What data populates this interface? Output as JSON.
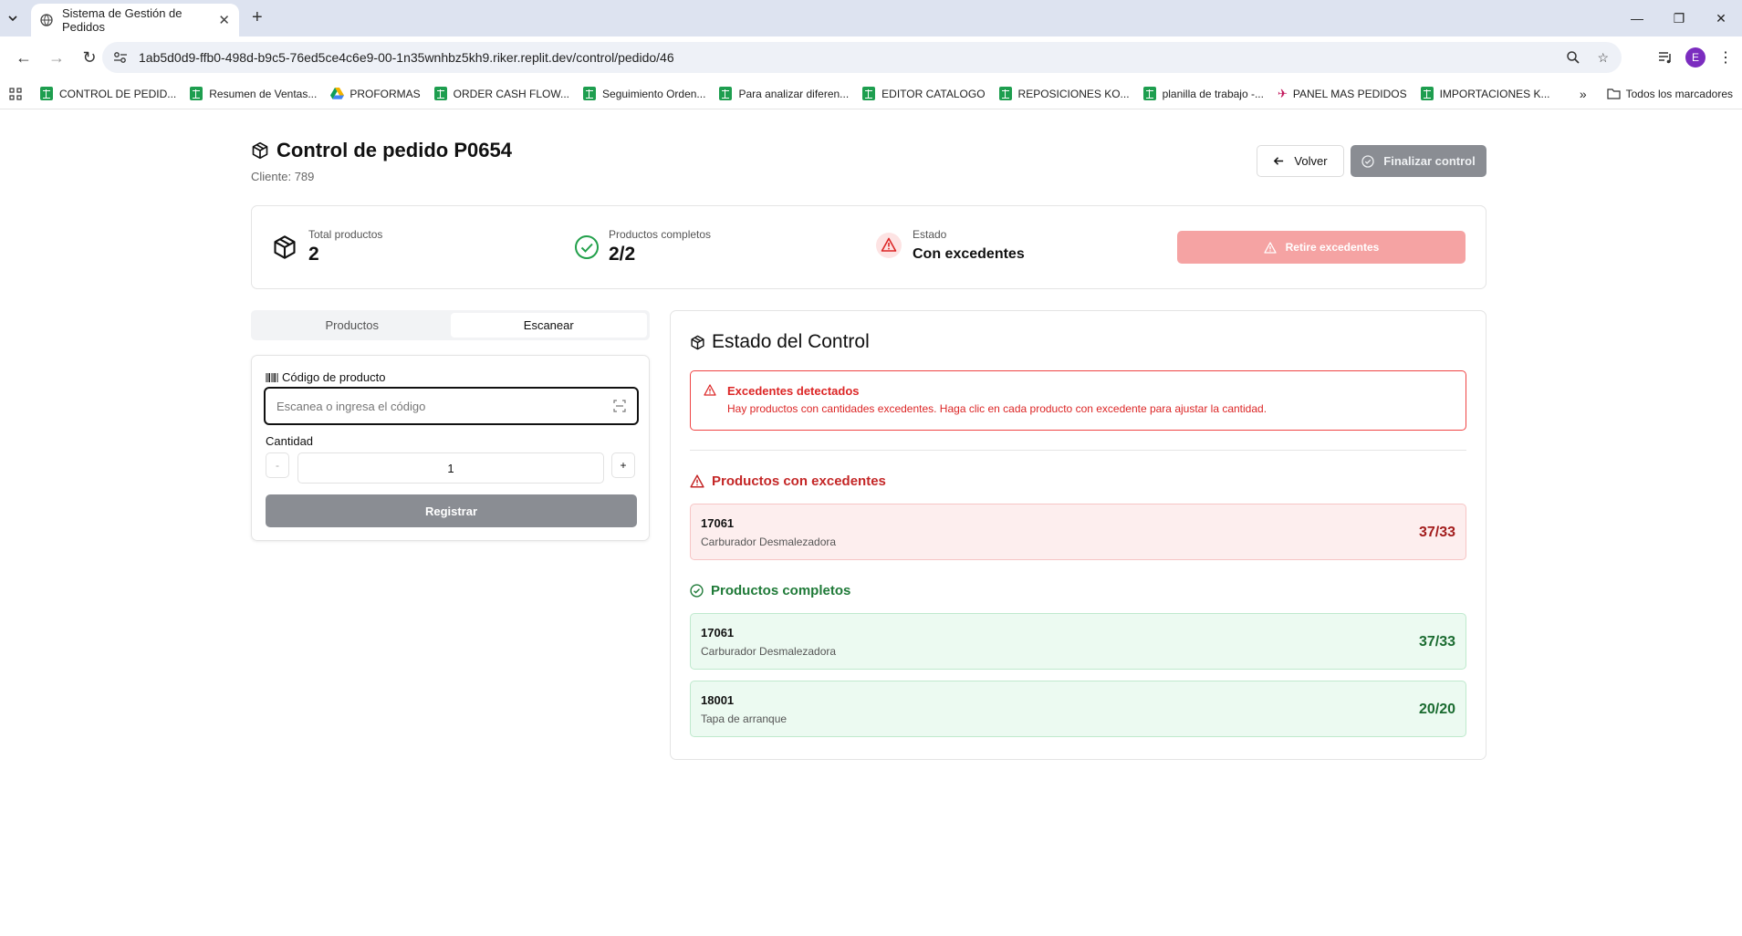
{
  "browser": {
    "tab_title": "Sistema de Gestión de Pedidos",
    "url": "1ab5d0d9-ffb0-498d-b9c5-76ed5ce4c6e9-00-1n35wnhbz5kh9.riker.replit.dev/control/pedido/46",
    "profile_initial": "E",
    "bookmarks": [
      {
        "label": "CONTROL DE PEDID...",
        "icon": "sheets-icon"
      },
      {
        "label": "Resumen de Ventas...",
        "icon": "sheets-icon"
      },
      {
        "label": "PROFORMAS",
        "icon": "drive-icon"
      },
      {
        "label": "ORDER CASH FLOW...",
        "icon": "sheets-icon"
      },
      {
        "label": "Seguimiento Orden...",
        "icon": "sheets-icon"
      },
      {
        "label": "Para analizar diferen...",
        "icon": "sheets-icon"
      },
      {
        "label": "EDITOR CATALOGO",
        "icon": "sheets-icon"
      },
      {
        "label": "REPOSICIONES KO...",
        "icon": "sheets-icon"
      },
      {
        "label": "planilla de trabajo -...",
        "icon": "sheets-icon"
      },
      {
        "label": "PANEL MAS PEDIDOS",
        "icon": "plane-icon"
      },
      {
        "label": "IMPORTACIONES K...",
        "icon": "sheets-icon"
      }
    ],
    "all_bookmarks": "Todos los marcadores"
  },
  "header": {
    "title": "Control de pedido P0654",
    "client": "Cliente: 789",
    "back_label": "Volver",
    "finalize_label": "Finalizar control"
  },
  "stats": {
    "total_label": "Total productos",
    "total_value": "2",
    "complete_label": "Productos completos",
    "complete_value": "2/2",
    "status_label": "Estado",
    "status_value": "Con excedentes",
    "action_label": "Retire excedentes"
  },
  "tabs": [
    {
      "label": "Productos",
      "active": false
    },
    {
      "label": "Escanear",
      "active": true
    }
  ],
  "scan": {
    "code_label": "Código de producto",
    "code_placeholder": "Escanea o ingresa el código",
    "code_value": "",
    "qty_label": "Cantidad",
    "qty_value": "1",
    "minus": "-",
    "plus": "+",
    "register_label": "Registrar"
  },
  "estado": {
    "title": "Estado del Control",
    "alert_title": "Excedentes detectados",
    "alert_desc": "Hay productos con cantidades excedentes. Haga clic en cada producto con excedente para ajustar la cantidad.",
    "excess_heading": "Productos con excedentes",
    "excess_items": [
      {
        "code": "17061",
        "name": "Carburador Desmalezadora",
        "count": "37/33"
      }
    ],
    "complete_heading": "Productos completos",
    "complete_items": [
      {
        "code": "17061",
        "name": "Carburador Desmalezadora",
        "count": "37/33"
      },
      {
        "code": "18001",
        "name": "Tapa de arranque",
        "count": "20/20"
      }
    ]
  },
  "colors": {
    "danger": "#dc2626",
    "success": "#1f7a38",
    "disabled_button": "#8a8d93",
    "retire_button": "#f5a3a3"
  }
}
